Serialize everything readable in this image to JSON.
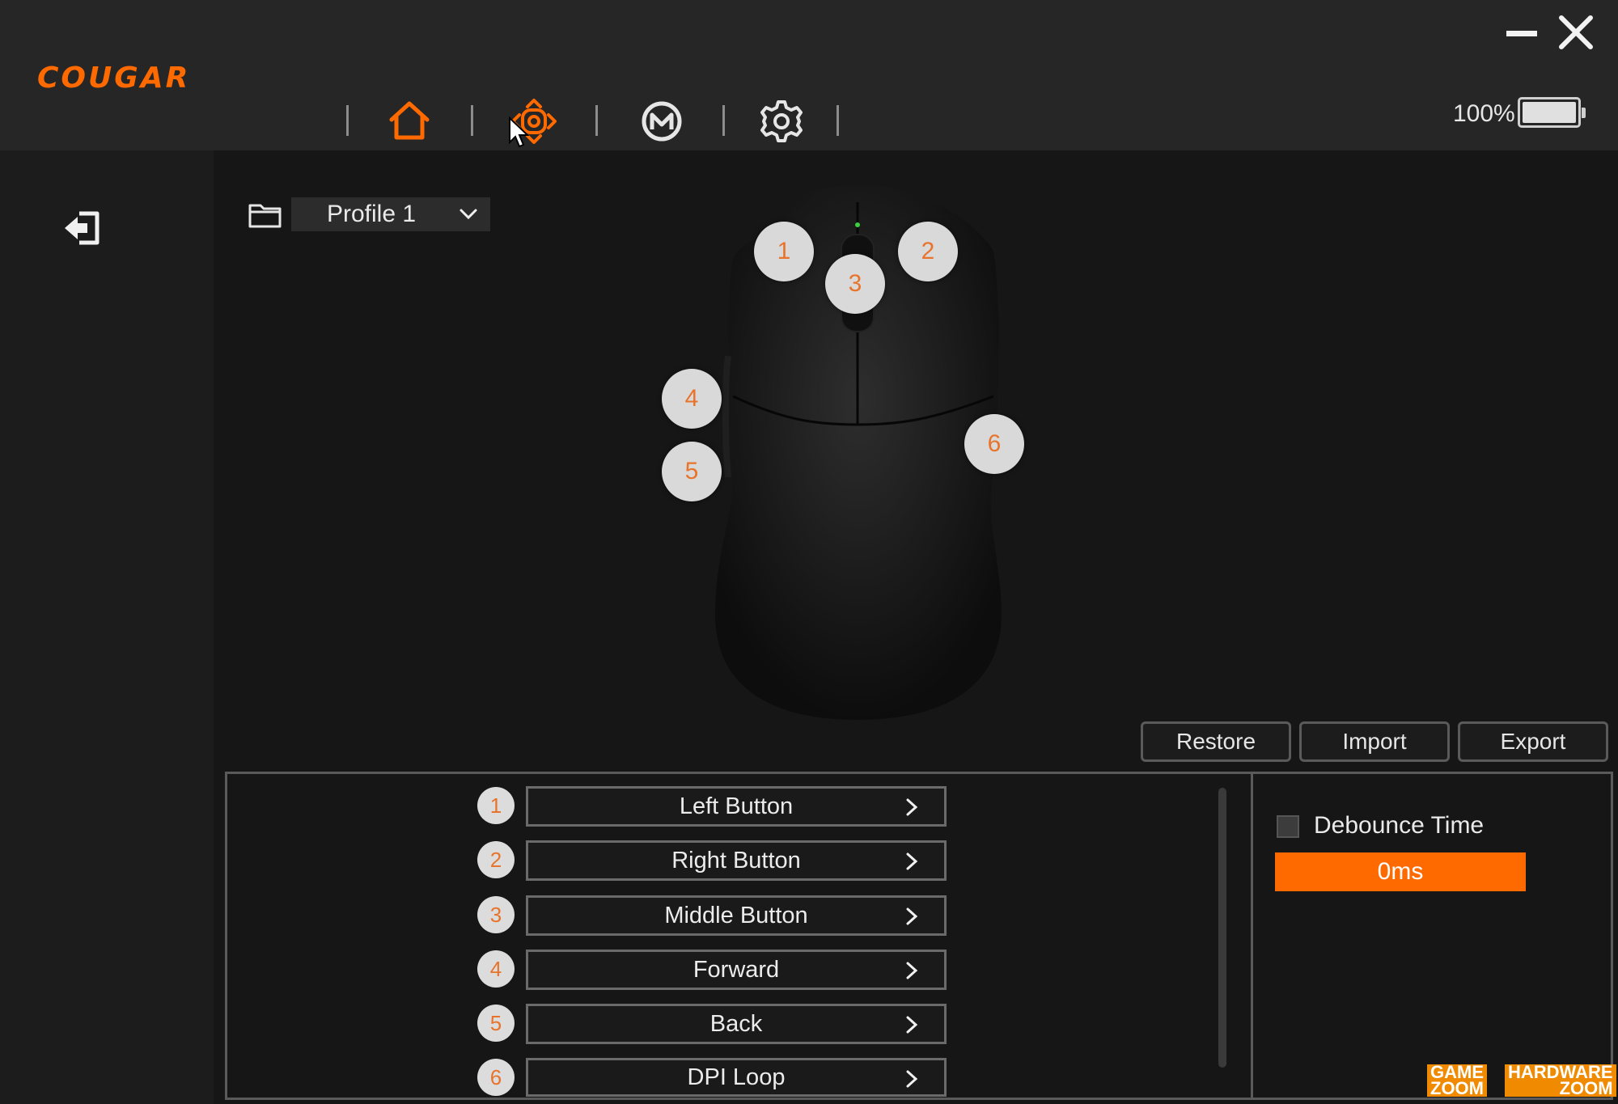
{
  "app": {
    "brand": "COUGAR"
  },
  "window": {
    "minimize_icon": "minimize-icon",
    "close_icon": "close-icon"
  },
  "nav": {
    "items": [
      {
        "name": "home",
        "icon": "home-icon",
        "active": true
      },
      {
        "name": "button-assign",
        "icon": "crosshair-icon",
        "active": false
      },
      {
        "name": "macro",
        "icon": "macro-m-icon",
        "active": false
      },
      {
        "name": "settings",
        "icon": "gear-icon",
        "active": false
      }
    ]
  },
  "battery": {
    "label": "100%",
    "level": 1.0
  },
  "profile": {
    "selected": "Profile 1"
  },
  "hotspots": [
    "1",
    "2",
    "3",
    "4",
    "5",
    "6"
  ],
  "actions": {
    "restore": "Restore",
    "import": "Import",
    "export": "Export"
  },
  "assignments": [
    {
      "num": "1",
      "label": "Left Button"
    },
    {
      "num": "2",
      "label": "Right Button"
    },
    {
      "num": "3",
      "label": "Middle Button"
    },
    {
      "num": "4",
      "label": "Forward"
    },
    {
      "num": "5",
      "label": "Back"
    },
    {
      "num": "6",
      "label": "DPI Loop"
    }
  ],
  "debounce": {
    "label": "Debounce Time",
    "value": "0ms",
    "checked": false
  },
  "watermarks": {
    "left_top": "GAME",
    "left_bottom": "ZOOM",
    "right_top": "HARDWARE",
    "right_bottom": "ZOOM"
  },
  "colors": {
    "accent": "#ff6a00",
    "hotspot_text": "#e8742c",
    "background": "#161616"
  }
}
